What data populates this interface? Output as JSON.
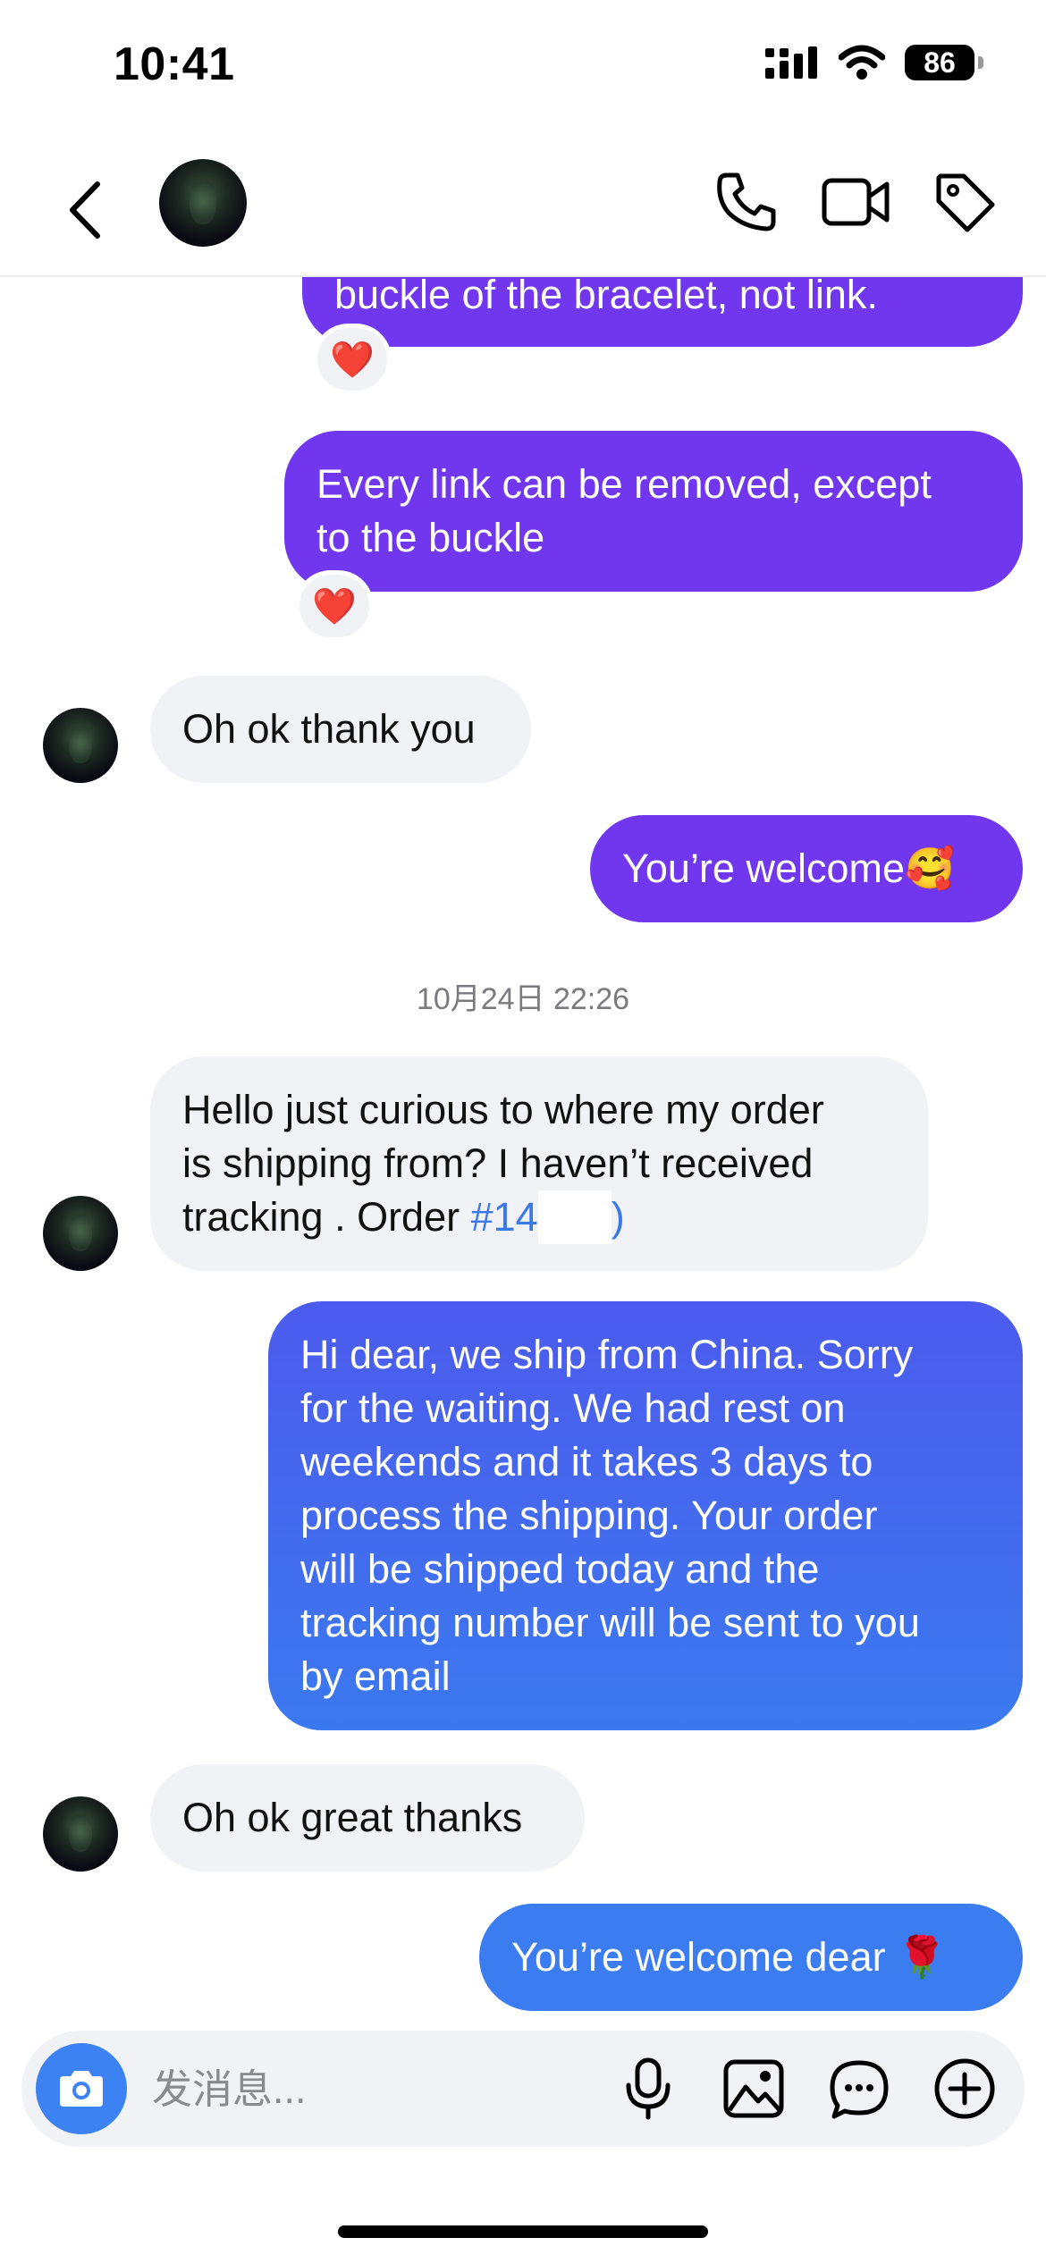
{
  "status_bar": {
    "time": "10:41",
    "battery": "86"
  },
  "header": {
    "back_icon": "chevron-left-icon",
    "actions": [
      "phone-icon",
      "video-camera-icon",
      "tag-icon"
    ]
  },
  "colors": {
    "outgoing_purple": "#7037ee",
    "outgoing_blue": "#3b7cf0",
    "incoming_gray": "#f1f2f5",
    "link_blue": "#3b78e8"
  },
  "messages": [
    {
      "direction": "outgoing",
      "text": "buckle of the bracelet, not link.",
      "reaction": "❤️"
    },
    {
      "direction": "outgoing",
      "text": "Every link can be removed, except\nto the buckle",
      "reaction": "❤️"
    },
    {
      "direction": "incoming",
      "text": "Oh ok thank you"
    },
    {
      "direction": "outgoing",
      "text": "You’re welcome🥰"
    },
    {
      "direction": "incoming",
      "text_prefix": "Hello just curious to where my order\nis shipping from? I haven’t received\ntracking . Order ",
      "link_text": "#14",
      "link_suffix": ")"
    },
    {
      "direction": "outgoing",
      "text": "Hi dear, we ship from China. Sorry\nfor the waiting. We had rest on\nweekends and it takes 3 days to\nprocess the shipping. Your order\nwill be shipped today and the\ntracking number will be sent to you\nby email"
    },
    {
      "direction": "incoming",
      "text": "Oh ok great thanks"
    },
    {
      "direction": "outgoing",
      "text": "You’re welcome dear 🌹"
    }
  ],
  "timestamp": "10月24日 22:26",
  "composer": {
    "placeholder": "发消息...",
    "camera_icon": "camera-icon",
    "icons": [
      "microphone-icon",
      "image-icon",
      "sticker-chat-icon",
      "plus-circle-icon"
    ]
  }
}
